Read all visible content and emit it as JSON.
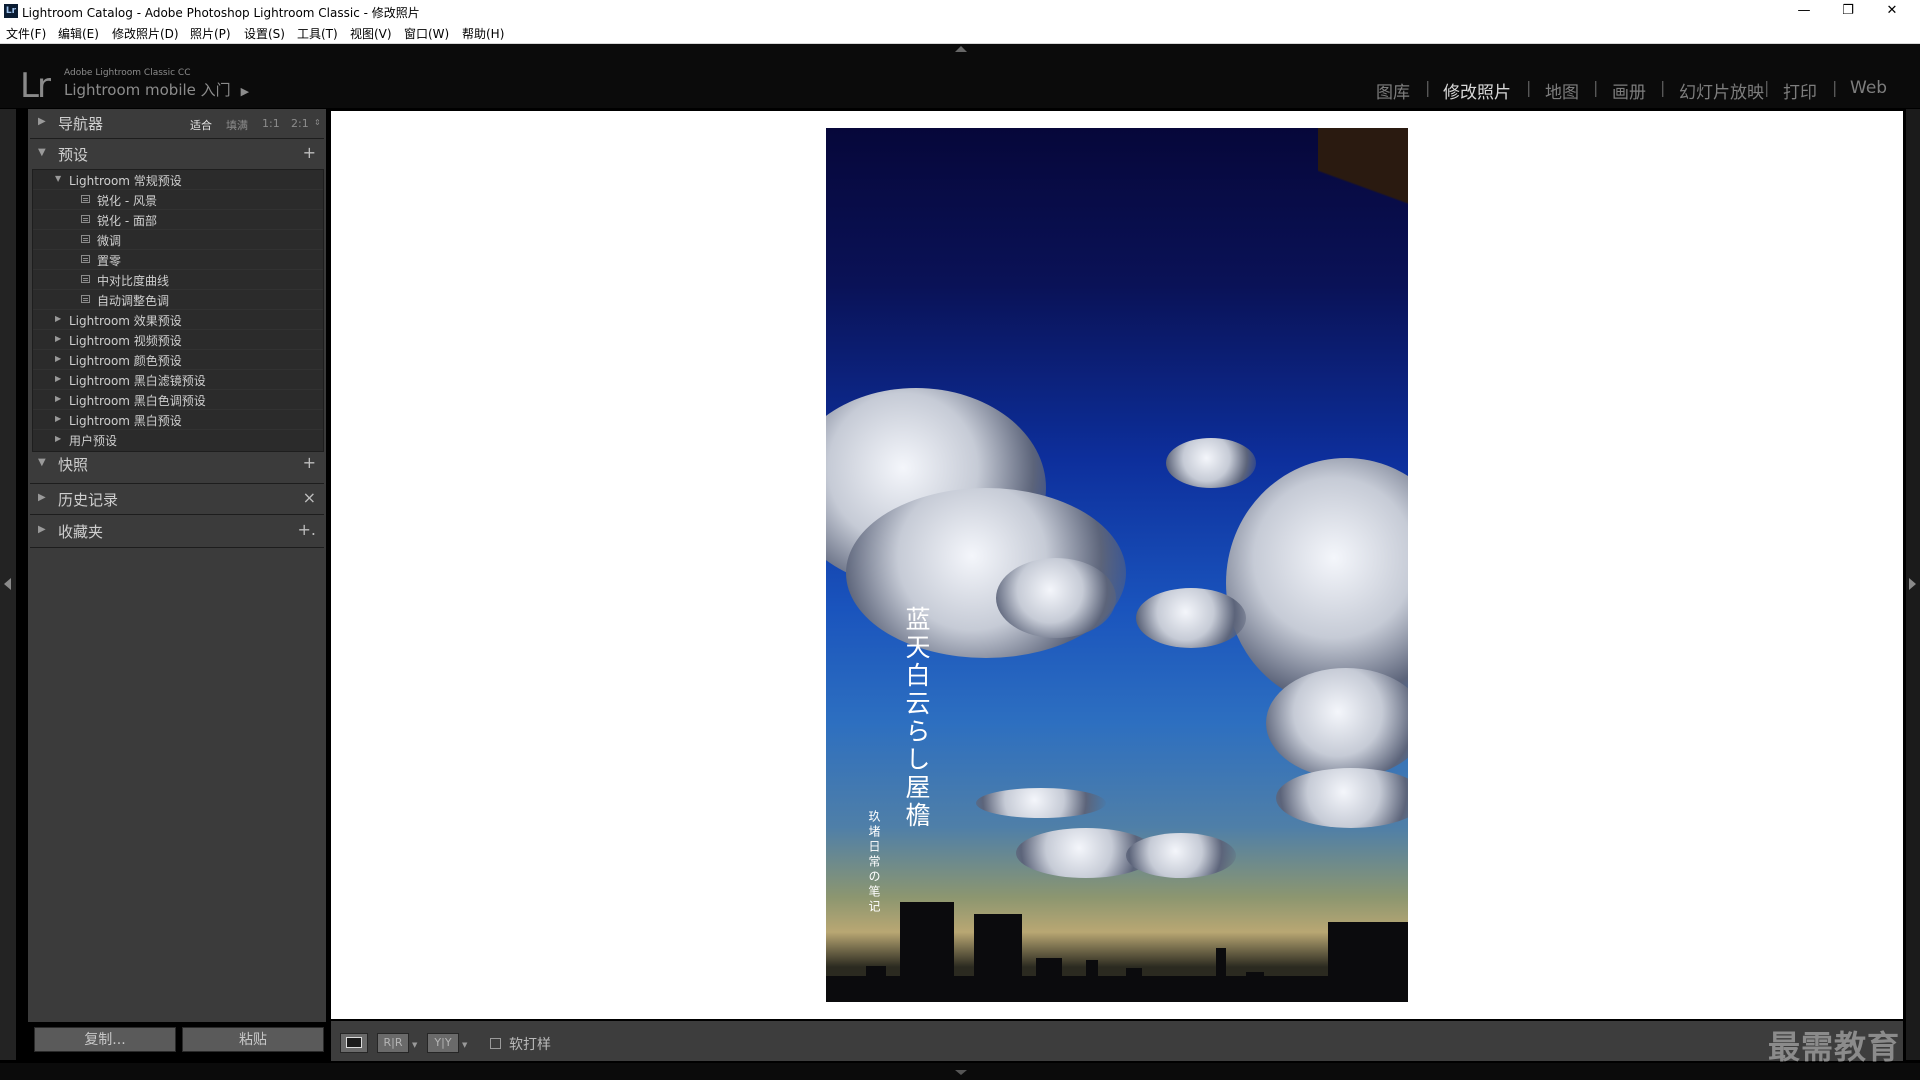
{
  "window": {
    "title": "Lightroom Catalog - Adobe Photoshop Lightroom Classic - 修改照片",
    "app_icon": "Lr",
    "controls": [
      "minimize-icon",
      "restore-icon",
      "close-icon"
    ]
  },
  "menubar": {
    "items": [
      "文件(F)",
      "编辑(E)",
      "修改照片(D)",
      "照片(P)",
      "设置(S)",
      "工具(T)",
      "视图(V)",
      "窗口(W)",
      "帮助(H)"
    ]
  },
  "identity": {
    "logo": "Lr",
    "subtitle": "Adobe Lightroom Classic CC",
    "mobile": "Lightroom mobile 入门"
  },
  "modules": {
    "items": [
      "图库",
      "修改照片",
      "地图",
      "画册",
      "幻灯片放映",
      "打印",
      "Web"
    ],
    "active": "修改照片",
    "separator": "|"
  },
  "left_panel": {
    "navigator": {
      "title": "导航器",
      "options": [
        "适合",
        "填满",
        "1:1",
        "2:1"
      ],
      "active": "适合"
    },
    "presets": {
      "title": "预设",
      "add_icon": "+",
      "groups": [
        {
          "label": "Lightroom 常规预设",
          "expanded": true,
          "children": [
            "锐化 - 风景",
            "锐化 - 面部",
            "微调",
            "置零",
            "中对比度曲线",
            "自动调整色调"
          ]
        },
        {
          "label": "Lightroom 效果预设",
          "expanded": false
        },
        {
          "label": "Lightroom 视频预设",
          "expanded": false
        },
        {
          "label": "Lightroom 颜色预设",
          "expanded": false
        },
        {
          "label": "Lightroom 黑白滤镜预设",
          "expanded": false
        },
        {
          "label": "Lightroom 黑白色调预设",
          "expanded": false
        },
        {
          "label": "Lightroom 黑白预设",
          "expanded": false
        },
        {
          "label": "用户预设",
          "expanded": false
        }
      ]
    },
    "snapshots": {
      "title": "快照",
      "action": "+"
    },
    "history": {
      "title": "历史记录",
      "action": "×"
    },
    "collections": {
      "title": "收藏夹",
      "action": "+."
    },
    "copy_button": "复制...",
    "paste_button": "粘贴"
  },
  "photo": {
    "title_text": "蓝天白云らし屋檐",
    "subtitle_text": "玖堵日常の笔记"
  },
  "toolbar": {
    "view_modes": [
      "loupe-view-icon",
      "before-after-lr-icon",
      "before-after-tb-icon"
    ],
    "before_after_label_1": "R|R",
    "before_after_label_2": "Y|Y",
    "softproof_label": "软打样",
    "softproof_checked": false
  },
  "watermark": "最需教育"
}
